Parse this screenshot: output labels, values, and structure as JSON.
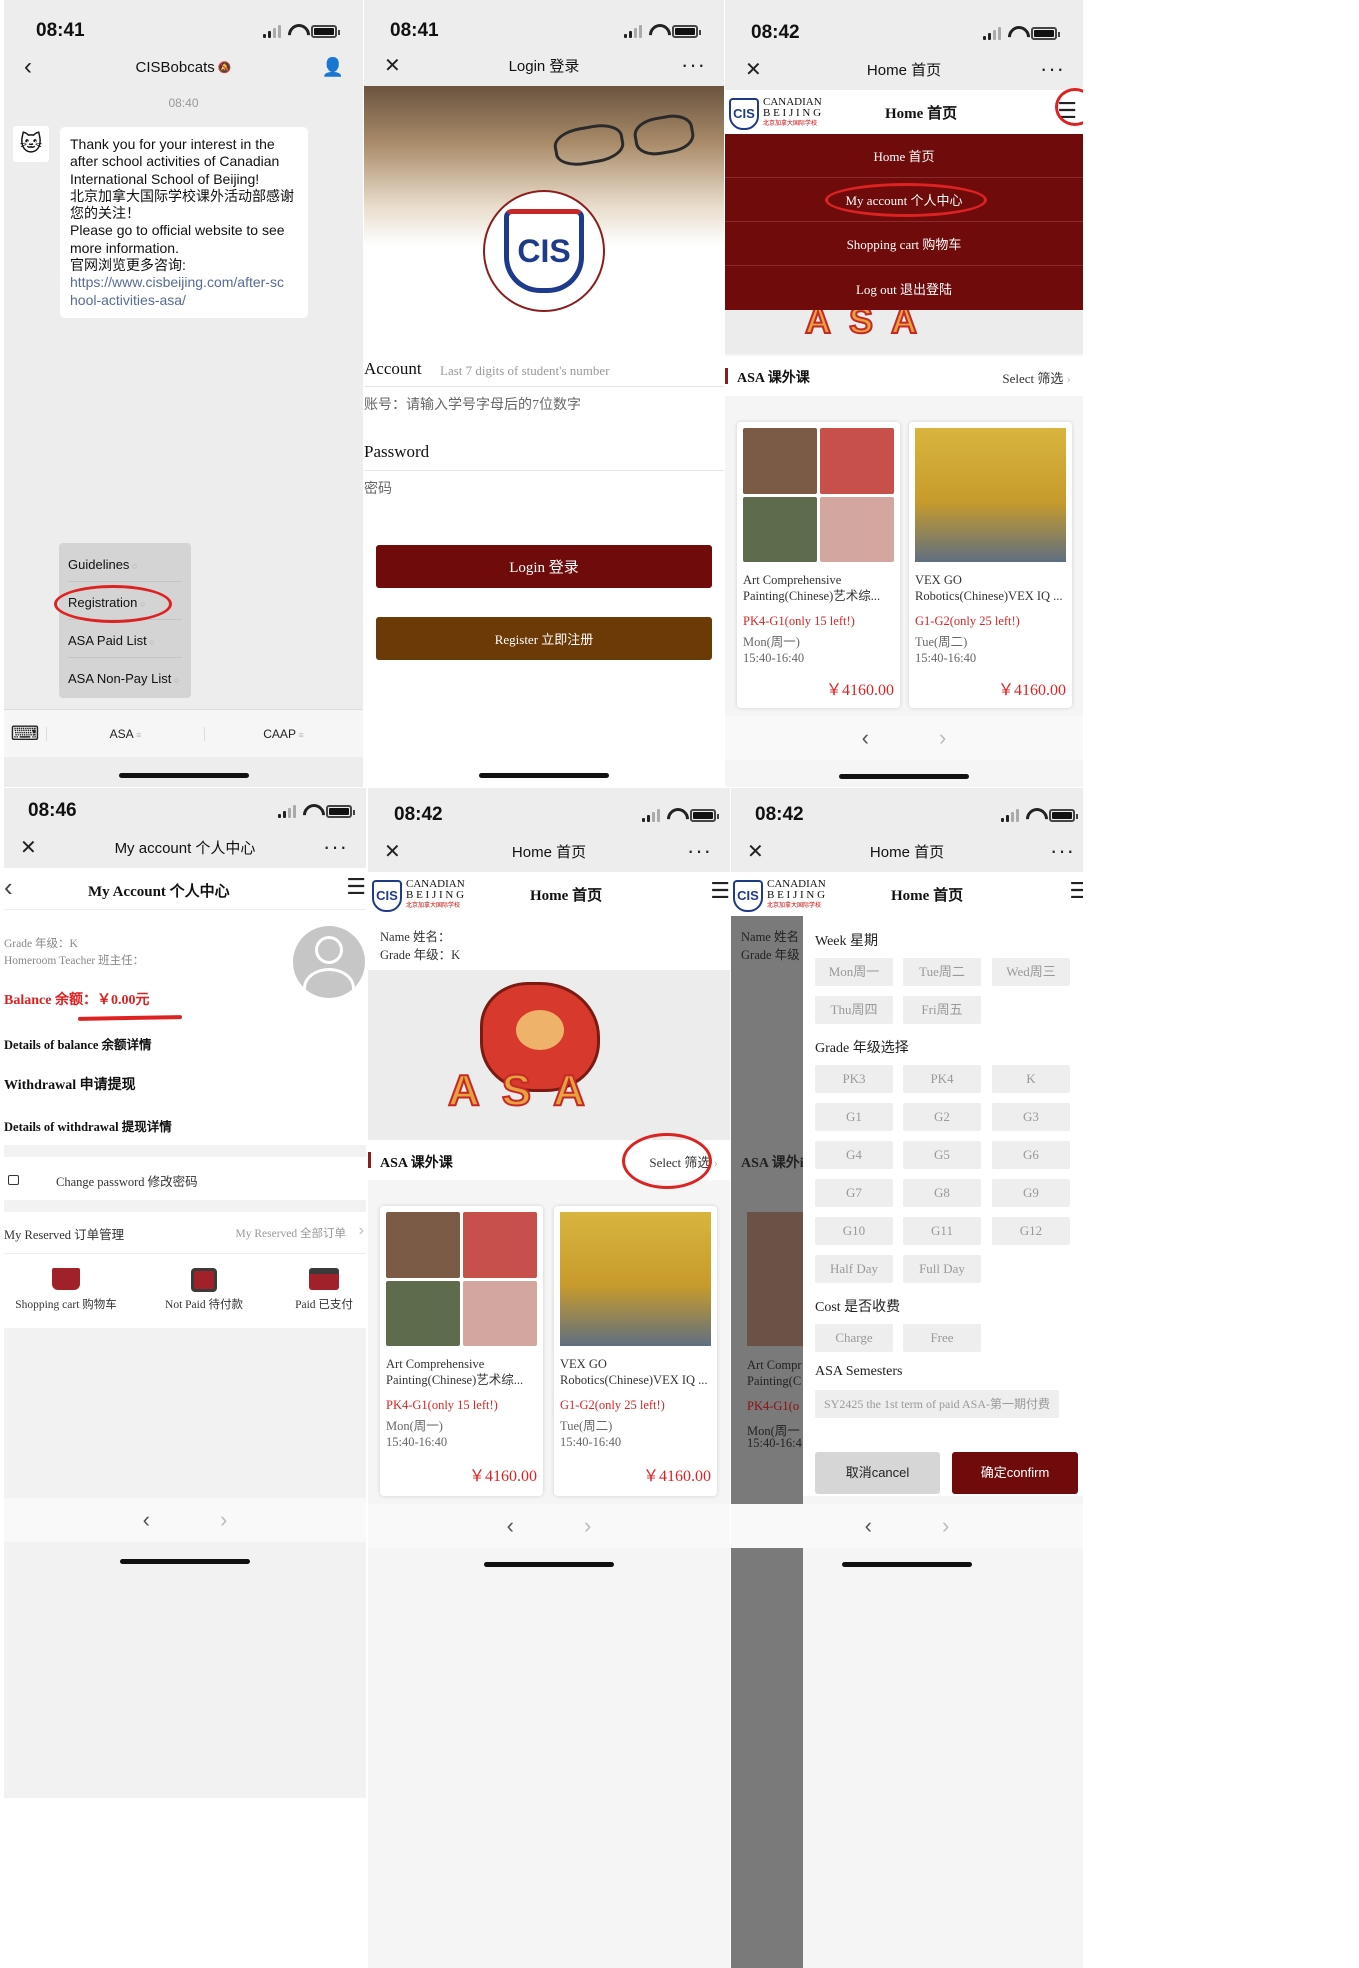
{
  "p1": {
    "time": "08:41",
    "title": "CISBobcats",
    "mute_icon": "mute-bell-icon",
    "timestamp": "08:40",
    "message": [
      "Thank you for your interest in the",
      "after school activities of Canadian",
      "International School of Beijing!",
      "北京加拿大国际学校课外活动部感谢",
      "您的关注！",
      "Please go to official website to see",
      "more information.",
      "官网浏览更多咨询:"
    ],
    "link": [
      "https://www.cisbeijing.com/after-sc",
      "hool-activities-asa/"
    ],
    "menu": [
      "Guidelines",
      "Registration",
      "ASA Paid List",
      "ASA Non-Pay List"
    ],
    "tabs": [
      "ASA",
      "CAAP"
    ]
  },
  "p2": {
    "time": "08:41",
    "title": "Login 登录",
    "account_label": "Account",
    "account_placeholder": "Last 7 digits of student's number",
    "account_hint": "账号：请输入学号字母后的7位数字",
    "password_label": "Password",
    "password_hint": "密码",
    "login_btn": "Login 登录",
    "register_btn": "Register 立即注册",
    "logo_text": "CIS"
  },
  "p3": {
    "time": "08:42",
    "title": "Home 首页",
    "header_title": "Home 首页",
    "menu": [
      "Home 首页",
      "My account 个人中心",
      "Shopping cart 购物车",
      "Log out 退出登陆"
    ],
    "section": "ASA 课外课",
    "select": "Select 筛选",
    "cards": [
      {
        "l1": "Art Comprehensive",
        "l2": "Painting(Chinese)艺术综...",
        "grade": "PK4-G1(only 15 left!)",
        "day": "Mon(周一)",
        "time": "15:40-16:40",
        "price": "￥4160.00"
      },
      {
        "l1": "VEX GO",
        "l2": "Robotics(Chinese)VEX IQ ...",
        "grade": "G1-G2(only 25 left!)",
        "day": "Tue(周二)",
        "time": "15:40-16:40",
        "price": "￥4160.00"
      }
    ]
  },
  "p4": {
    "time": "08:46",
    "title": "My account 个人中心",
    "header_title": "My Account 个人中心",
    "grade": "Grade 年级：K",
    "teacher": "Homeroom Teacher 班主任：",
    "balance": "Balance 余额：￥0.00元",
    "details_balance": "Details of balance 余额详情",
    "withdrawal": "Withdrawal 申请提现",
    "details_withdrawal": "Details of withdrawal 提现详情",
    "change_pw": "Change password 修改密码",
    "reserved": "My Reserved 订单管理",
    "reserved_all": "My Reserved 全部订单",
    "icons": [
      "Shopping cart 购物车",
      "Not Paid 待付款",
      "Paid 已支付"
    ]
  },
  "p5": {
    "time": "08:42",
    "title": "Home 首页",
    "header_title": "Home 首页",
    "name": "Name 姓名：",
    "grade": "Grade 年级：K",
    "section": "ASA 课外课",
    "select": "Select 筛选"
  },
  "p6": {
    "time": "08:42",
    "title": "Home 首页",
    "header_title": "Home 首页",
    "name": "Name 姓名",
    "grade": "Grade 年级",
    "section": "ASA 课外i",
    "week_label": "Week 星期",
    "week": [
      "Mon周一",
      "Tue周二",
      "Wed周三",
      "Thu周四",
      "Fri周五"
    ],
    "grade_label": "Grade 年级选择",
    "grades": [
      "PK3",
      "PK4",
      "K",
      "G1",
      "G2",
      "G3",
      "G4",
      "G5",
      "G6",
      "G7",
      "G8",
      "G9",
      "G10",
      "G11",
      "G12",
      "Half Day",
      "Full Day"
    ],
    "cost_label": "Cost 是否收费",
    "cost": [
      "Charge",
      "Free"
    ],
    "sem_label": "ASA Semesters",
    "sem": "SY2425 the 1st term of paid ASA-第一期付费",
    "cancel": "取消cancel",
    "confirm": "确定confirm",
    "card_l1": "Art Compr",
    "card_l2": "Painting(C",
    "card_grade": "PK4-G1(o",
    "card_day": "Mon(周一",
    "card_time": "15:40-16:4"
  },
  "logo": {
    "mark": "CIS",
    "line1": "CANADIAN",
    "line2": "B E I J I N G",
    "line3": "北京加拿大国际学校"
  }
}
